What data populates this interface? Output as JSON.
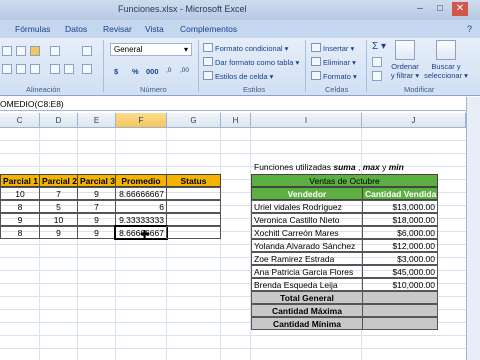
{
  "window": {
    "title": "Funciones.xlsx - Microsoft Excel",
    "minimize": "–",
    "maximize": "□",
    "close": "✕"
  },
  "ribbon": {
    "tabs": [
      "Fórmulas",
      "Datos",
      "Revisar",
      "Vista",
      "Complementos"
    ],
    "help_icon": "?",
    "number_format": "General",
    "number_format_arrow": "▾",
    "currency_symbol": "$",
    "percent_symbol": "%",
    "thousands_symbol": "000",
    "decimals_more": ",0",
    "decimals_less": ",00",
    "groups": {
      "alignment": "Alineación",
      "number": "Número",
      "styles": "Estilos",
      "cells": "Celdas",
      "editing": "Modificar"
    },
    "styles_buttons": [
      "Formato condicional ▾",
      "Dar formato como tabla ▾",
      "Estilos de celda ▾"
    ],
    "cells_buttons": [
      "Insertar ▾",
      "Eliminar ▾",
      "Formato ▾"
    ],
    "editing": {
      "sum_symbol": "Σ ▾",
      "sort_label_1": "Ordenar",
      "sort_label_2": "y filtrar ▾",
      "find_label_1": "Buscar y",
      "find_label_2": "seleccionar ▾"
    }
  },
  "formula_bar": {
    "text": "OMEDIO(C8:E8)"
  },
  "columns": [
    "C",
    "D",
    "E",
    "F",
    "G",
    "H",
    "I",
    "J"
  ],
  "grades_table": {
    "headers": [
      "Parcial 1",
      "Parcial 2",
      "Parcial 3",
      "Promedio",
      "Status"
    ],
    "rows": [
      {
        "p1": "10",
        "p2": "7",
        "p3": "9",
        "prom": "8.66666667",
        "status": ""
      },
      {
        "p1": "8",
        "p2": "5",
        "p3": "7",
        "prom": "6",
        "status": ""
      },
      {
        "p1": "9",
        "p2": "10",
        "p3": "9",
        "prom": "9.33333333",
        "status": ""
      },
      {
        "p1": "8",
        "p2": "9",
        "p3": "9",
        "prom": "8.66666667",
        "status": ""
      }
    ]
  },
  "sales": {
    "caption_prefix": "Funciones utilizadas ",
    "caption_suma": "suma",
    "caption_sep1": " , ",
    "caption_max": "max",
    "caption_sep2": " y ",
    "caption_min": "min",
    "title": "Ventas de Octubre",
    "header_vendor": "Vendedor",
    "header_amount": "Cantidad Vendida",
    "rows": [
      {
        "name": "Uriel vidales Rodríguez",
        "amount": "$13,000.00"
      },
      {
        "name": "Veronica Castillo Nieto",
        "amount": "$18,000.00"
      },
      {
        "name": "Xochitl Carreón Mares",
        "amount": "$6,000.00"
      },
      {
        "name": "Yolanda Alvarado Sánchez",
        "amount": "$12,000.00"
      },
      {
        "name": "Zoe Ramirez Estrada",
        "amount": "$3,000.00"
      },
      {
        "name": "Ana Patricia Garcia Flores",
        "amount": "$45,000.00"
      },
      {
        "name": "Brenda Esqueda Leija",
        "amount": "$10,000.00"
      }
    ],
    "total_general": "Total General",
    "cantidad_maxima": "Cantidad Máxima",
    "cantidad_minima": "Cantidad Mínima"
  },
  "colors": {
    "header_yellow": "#f4b400",
    "header_green": "#5bb041",
    "summary_gray": "#c8c8c8"
  }
}
